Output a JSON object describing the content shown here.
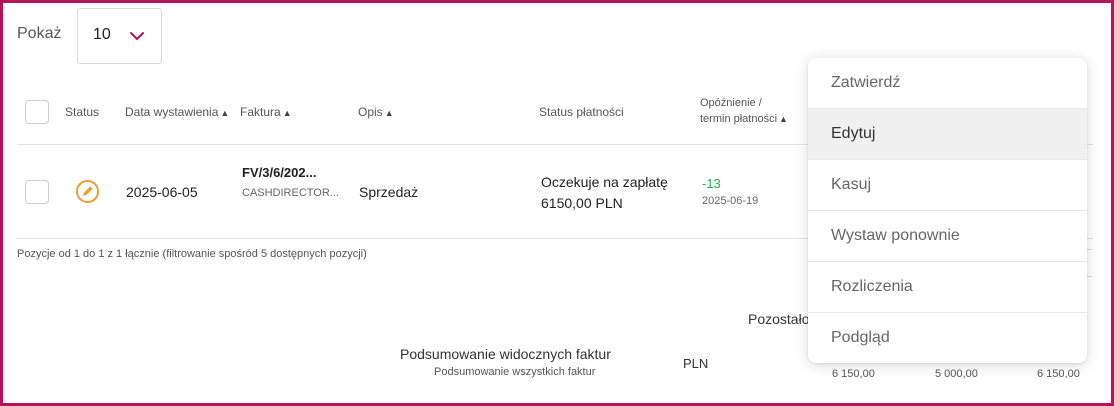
{
  "show": {
    "label": "Pokaż",
    "value": "10"
  },
  "table": {
    "headers": {
      "status": "Status",
      "issue_date": "Data wystawienia",
      "invoice": "Faktura",
      "description": "Opis",
      "payment_status": "Status płatności",
      "delay_line1": "Opóźnienie /",
      "delay_line2": "termin płatności"
    },
    "rows": [
      {
        "issue_date": "2025-06-05",
        "invoice_number": "FV/3/6/202...",
        "invoice_client": "CASHDIRECTOR...",
        "description": "Sprzedaż",
        "payment_status": "Oczekuje na zapłatę",
        "payment_amount": "6150,00 PLN",
        "delay": "-13",
        "due_date": "2025-06-19"
      }
    ]
  },
  "info_text": "Pozycje od 1 do 1 z 1 łącznie (filtrowanie spośród 5 dostępnych pozycji)",
  "summary": {
    "remaining_label": "Pozostało",
    "visible_label": "Podsumowanie widocznych faktur",
    "all_label": "Podsumowanie wszystkich faktur",
    "currency": "PLN",
    "values": [
      "6 150,00",
      "5 000,00",
      "6 150,00"
    ]
  },
  "menu": {
    "items": [
      "Zatwierdź",
      "Edytuj",
      "Kasuj",
      "Wystaw ponownie",
      "Rozliczenia",
      "Podgląd"
    ],
    "hovered_index": 1
  },
  "colors": {
    "frame": "#b5135a",
    "accent_chevron": "#b5135a",
    "status_icon": "#f29a2e",
    "delay_negative": "#22b14c"
  },
  "icons": {
    "select": "chevron-down-icon",
    "status": "pencil-circle-icon",
    "sort": "sort-icon"
  }
}
